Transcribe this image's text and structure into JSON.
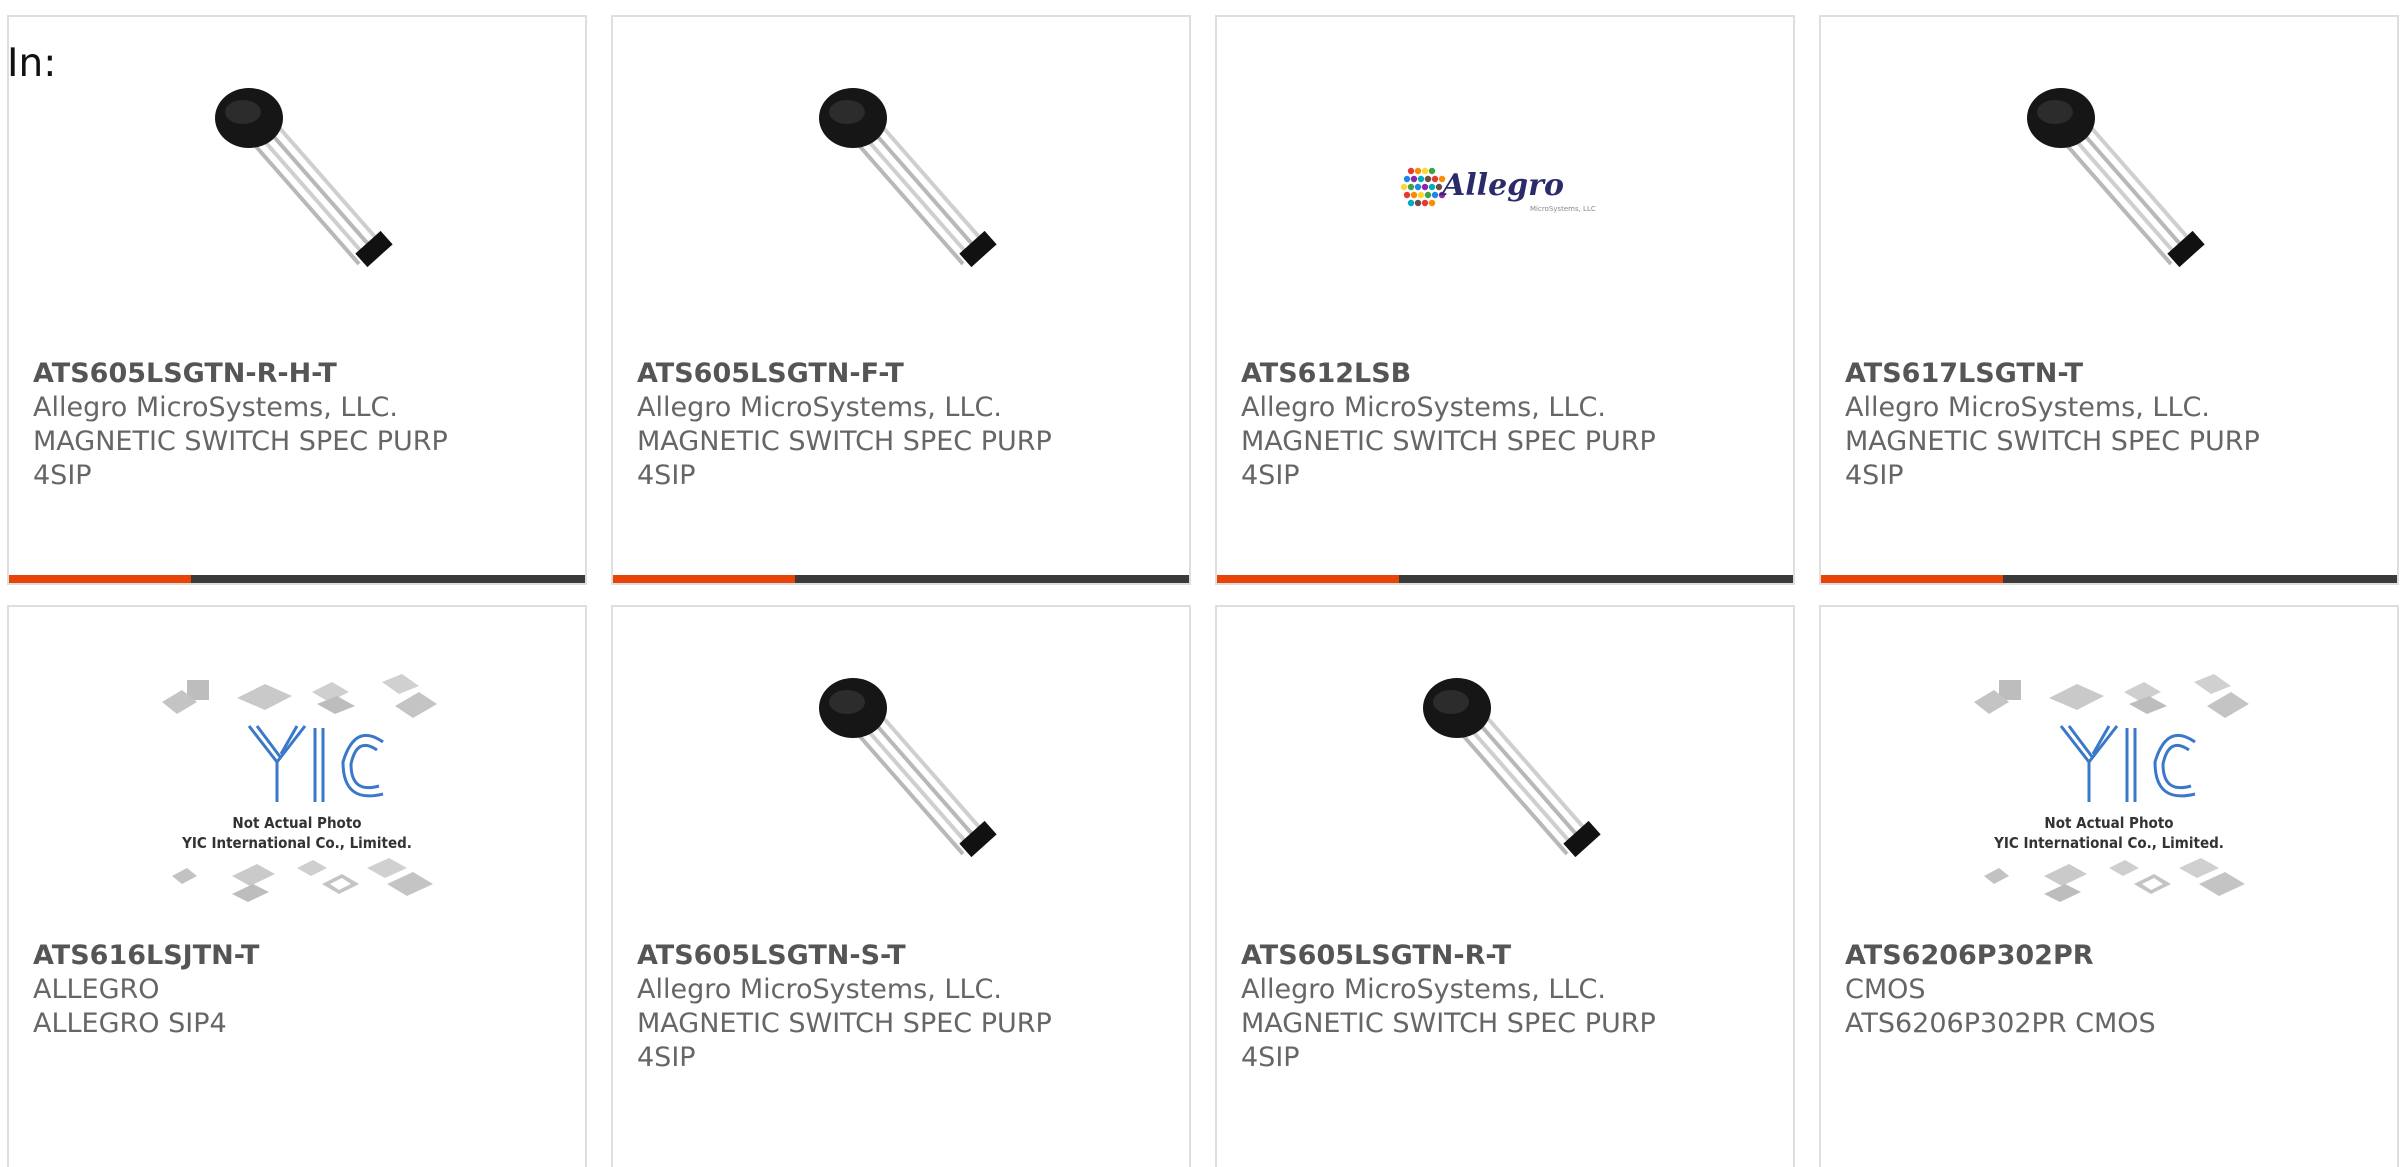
{
  "filter": {
    "label": "In:"
  },
  "colors": {
    "accent": "#e8440a",
    "bar_track": "#3a3a3a"
  },
  "products": [
    {
      "part_number": "ATS605LSGTN-R-H-T",
      "manufacturer": "Allegro MicroSystems, LLC.",
      "description_line1": "MAGNETIC SWITCH SPEC PURP",
      "description_line2": "4SIP",
      "image": "hall-sensor-photo",
      "progress_fraction": 0.316
    },
    {
      "part_number": "ATS605LSGTN-F-T",
      "manufacturer": "Allegro MicroSystems, LLC.",
      "description_line1": "MAGNETIC SWITCH SPEC PURP",
      "description_line2": "4SIP",
      "image": "hall-sensor-photo",
      "progress_fraction": 0.316
    },
    {
      "part_number": "ATS612LSB",
      "manufacturer": "Allegro MicroSystems, LLC.",
      "description_line1": "MAGNETIC SWITCH SPEC PURP",
      "description_line2": "4SIP",
      "image": "allegro-logo",
      "logo_text": "Allegro",
      "logo_subtext": "MicroSystems, LLC",
      "progress_fraction": 0.316
    },
    {
      "part_number": "ATS617LSGTN-T",
      "manufacturer": "Allegro MicroSystems, LLC.",
      "description_line1": "MAGNETIC SWITCH SPEC PURP",
      "description_line2": "4SIP",
      "image": "hall-sensor-photo",
      "progress_fraction": 0.316
    },
    {
      "part_number": "ATS616LSJTN-T",
      "manufacturer": "ALLEGRO",
      "description_line1": "ALLEGRO SIP4",
      "description_line2": "",
      "image": "yic-placeholder",
      "placeholder_line1": "Not Actual Photo",
      "placeholder_line2": "YIC International Co., Limited."
    },
    {
      "part_number": "ATS605LSGTN-S-T",
      "manufacturer": "Allegro MicroSystems, LLC.",
      "description_line1": "MAGNETIC SWITCH SPEC PURP",
      "description_line2": "4SIP",
      "image": "hall-sensor-photo"
    },
    {
      "part_number": "ATS605LSGTN-R-T",
      "manufacturer": "Allegro MicroSystems, LLC.",
      "description_line1": "MAGNETIC SWITCH SPEC PURP",
      "description_line2": "4SIP",
      "image": "hall-sensor-photo"
    },
    {
      "part_number": "ATS6206P302PR",
      "manufacturer": "CMOS",
      "description_line1": "ATS6206P302PR CMOS",
      "description_line2": "",
      "image": "yic-placeholder",
      "placeholder_line1": "Not Actual Photo",
      "placeholder_line2": "YIC International Co., Limited."
    }
  ]
}
